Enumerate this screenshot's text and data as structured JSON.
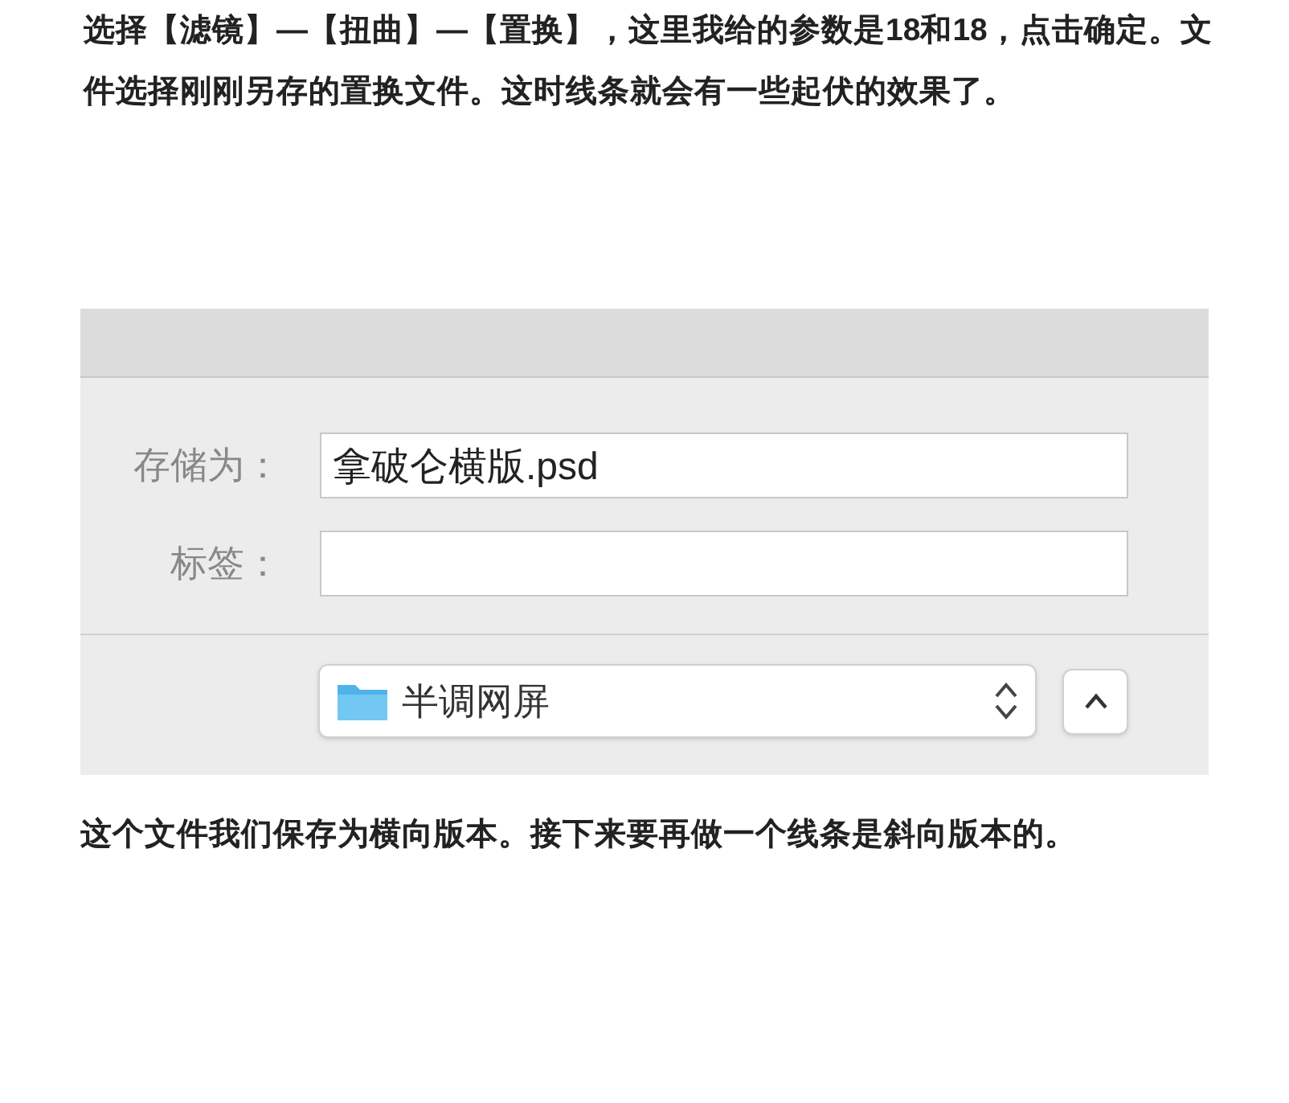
{
  "intro": "选择【滤镜】—【扭曲】—【置换】，这里我给的参数是18和18，点击确定。文件选择刚刚另存的置换文件。这时线条就会有一些起伏的效果了。",
  "dialog": {
    "fields": [
      {
        "label": "存储为：",
        "value": "拿破仑横版.psd"
      },
      {
        "label": "标签："
      }
    ],
    "location": {
      "value": "半调网屏"
    }
  },
  "outro": "这个文件我们保存为横向版本。接下来要再做一个线条是斜向版本的。"
}
